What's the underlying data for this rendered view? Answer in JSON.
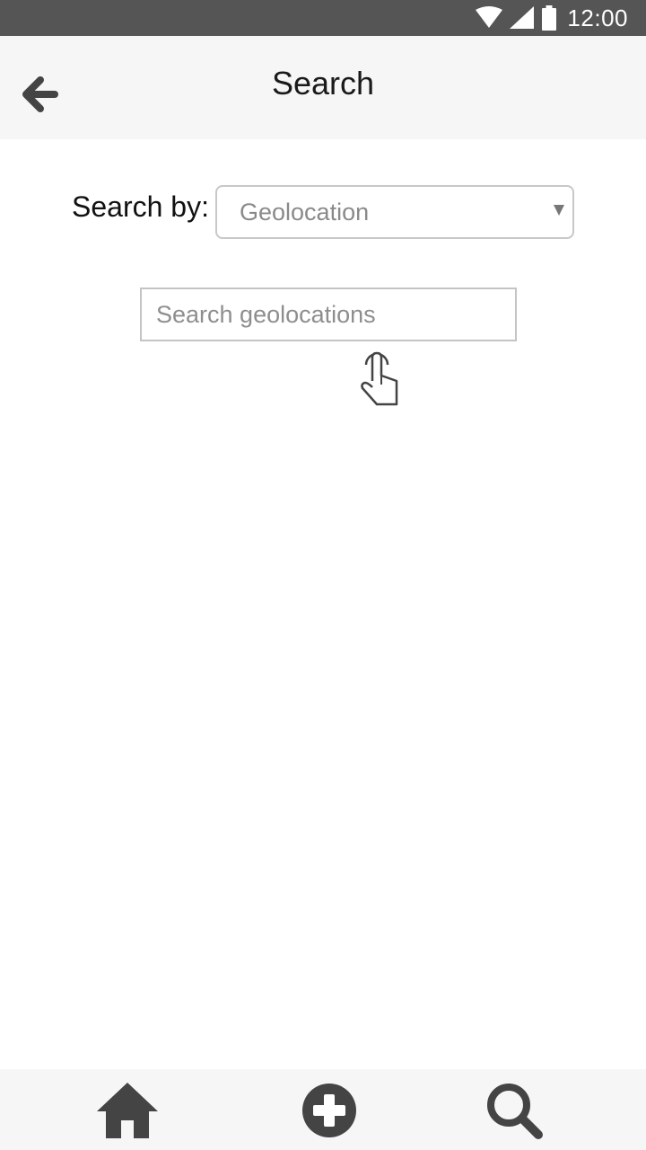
{
  "status_bar": {
    "time": "12:00",
    "icons": [
      "wifi-icon",
      "signal-icon",
      "battery-icon"
    ]
  },
  "app_bar": {
    "title": "Search",
    "back_icon": "arrow-left-icon"
  },
  "search_by": {
    "label": "Search by:",
    "selected": "Geolocation"
  },
  "search": {
    "placeholder": "Search geolocations",
    "value": ""
  },
  "bottom_nav": {
    "items": [
      "home-icon",
      "add-circle-icon",
      "search-icon"
    ]
  },
  "colors": {
    "status_bar": "#555555",
    "app_bar": "#f6f6f6",
    "icon": "#444444",
    "border": "#c8c8c8"
  }
}
